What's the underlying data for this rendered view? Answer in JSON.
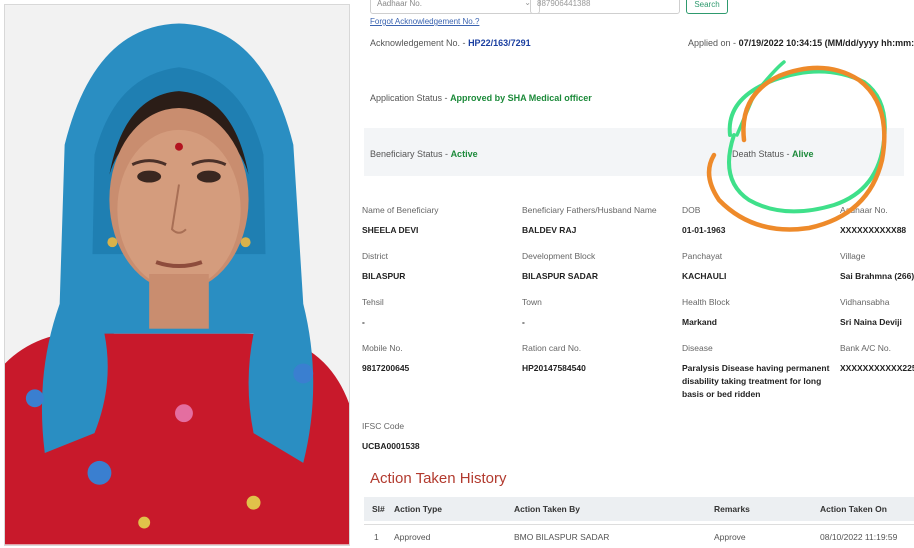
{
  "search": {
    "select_value": "Aadhaar No.",
    "input_value": "887906441388",
    "button_label": "Search",
    "forgot_link": "Forgot Acknowledgement No.?"
  },
  "acknowledgement": {
    "label": "Acknowledgement No. -",
    "value": "HP22/163/7291",
    "applied_label": "Applied on -",
    "applied_value": "07/19/2022 10:34:15",
    "applied_format": "(MM/dd/yyyy hh:mm:ss)"
  },
  "application_status": {
    "label": "Application Status -",
    "value": "Approved by SHA Medical officer"
  },
  "beneficiary_status": {
    "label": "Beneficiary Status -",
    "value": "Active"
  },
  "death_status": {
    "label": "Death Status -",
    "value": "Alive"
  },
  "details": {
    "name_label": "Name of Beneficiary",
    "name_value": "SHEELA DEVI",
    "father_label": "Beneficiary Fathers/Husband Name",
    "father_value": "BALDEV RAJ",
    "dob_label": "DOB",
    "dob_value": "01-01-1963",
    "aadhaar_label": "Aadhaar No.",
    "aadhaar_value": "XXXXXXXXXX88",
    "district_label": "District",
    "district_value": "BILASPUR",
    "block_label": "Development Block",
    "block_value": "BILASPUR SADAR",
    "panchayat_label": "Panchayat",
    "panchayat_value": "KACHAULI",
    "village_label": "Village",
    "village_value": "Sai Brahmna (266)",
    "tehsil_label": "Tehsil",
    "tehsil_value": "-",
    "town_label": "Town",
    "town_value": "-",
    "health_label": "Health Block",
    "health_value": "Markand",
    "vidhansabha_label": "Vidhansabha",
    "vidhansabha_value": "Sri Naina Deviji",
    "mobile_label": "Mobile No.",
    "mobile_value": "9817200645",
    "ration_label": "Ration card No.",
    "ration_value": "HP20147584540",
    "disease_label": "Disease",
    "disease_value": "Paralysis Disease having permanent disability taking treatment for long basis or bed ridden",
    "bank_label": "Bank A/C No.",
    "bank_value": "XXXXXXXXXXX225",
    "ifsc_label": "IFSC Code",
    "ifsc_value": "UCBA0001538"
  },
  "history": {
    "title": "Action Taken History",
    "columns": [
      "Sl#",
      "Action Type",
      "Action Taken By",
      "Remarks",
      "Action Taken On"
    ],
    "rows": [
      [
        "1",
        "Approved",
        "BMO BILASPUR SADAR",
        "Approve",
        "08/10/2022 11:19:59"
      ]
    ]
  },
  "colors": {
    "annotation_green": "#3fe08a",
    "annotation_orange": "#ee8a2a",
    "title_red": "#b23a2e",
    "status_green": "#1c8a3a",
    "ack_blue": "#1b3fa0"
  }
}
